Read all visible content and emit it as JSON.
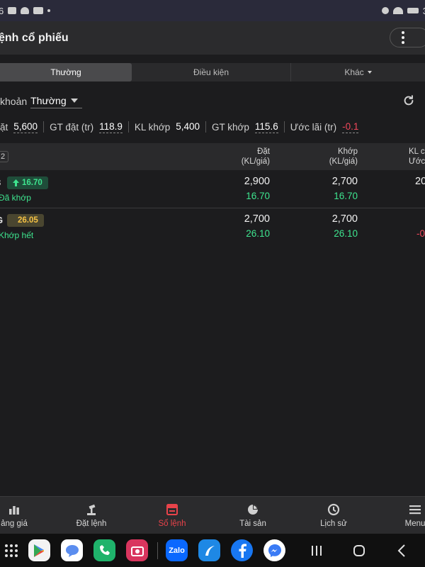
{
  "status_bar": {
    "time_fragment": "6",
    "right_fragment": "3"
  },
  "header": {
    "title": "ệnh cổ phiếu"
  },
  "tabs": [
    {
      "label": "Thường",
      "active": true
    },
    {
      "label": "Điều kiện",
      "active": false
    },
    {
      "label": "Khác",
      "active": false
    }
  ],
  "account": {
    "label": "khoản",
    "value": "Thường"
  },
  "summary": {
    "items": [
      {
        "key": "ặt",
        "value": "5,600"
      },
      {
        "key": "GT đặt (tr)",
        "value": "118.9"
      },
      {
        "key": "KL khớp",
        "value": "5,400"
      },
      {
        "key": "GT khớp",
        "value": "115.6"
      },
      {
        "key": "Ước lãi (tr)",
        "value": "-0.1"
      }
    ]
  },
  "table": {
    "count": "2",
    "headers": {
      "placed_line1": "Đặt",
      "placed_line2": "(KL/giá)",
      "matched_line1": "Khớp",
      "matched_line2": "(KL/giá)",
      "extra_line1": "KL c",
      "extra_line2": "Ước"
    },
    "rows": [
      {
        "edge": "3",
        "tag_price": "16.70",
        "tag_kind": "up",
        "status": "Đã khớp",
        "placed_qty": "2,900",
        "placed_price": "16.70",
        "matched_qty": "2,700",
        "matched_price": "16.70",
        "extra_top": "20",
        "extra_bottom": ""
      },
      {
        "edge": "G",
        "tag_price": "26.05",
        "tag_kind": "ref",
        "status": "Khớp hết",
        "placed_qty": "2,700",
        "placed_price": "26.10",
        "matched_qty": "2,700",
        "matched_price": "26.10",
        "extra_top": "",
        "extra_bottom": "-0"
      }
    ]
  },
  "bottom_nav": [
    {
      "label": "ảng giá",
      "icon": "chart-bars-icon",
      "active": false
    },
    {
      "label": "Đặt lệnh",
      "icon": "gavel-icon",
      "active": false
    },
    {
      "label": "Sổ lệnh",
      "icon": "order-book-icon",
      "active": true
    },
    {
      "label": "Tài sản",
      "icon": "pie-chart-icon",
      "active": false
    },
    {
      "label": "Lịch sử",
      "icon": "clock-icon",
      "active": false
    },
    {
      "label": "Menu",
      "icon": "hamburger-icon",
      "active": false
    }
  ],
  "dock": {
    "apps": [
      {
        "name": "play-store-icon",
        "color": "#ffffff"
      },
      {
        "name": "messages-icon",
        "color": "#5b8def"
      },
      {
        "name": "phone-icon",
        "color": "#1fb36b"
      },
      {
        "name": "camera-icon",
        "color": "#d9355e"
      },
      {
        "name": "zalo-icon",
        "color": "#0a68ff",
        "text": "Zalo"
      },
      {
        "name": "fireant-icon",
        "color": "#1e88e5"
      },
      {
        "name": "facebook-icon",
        "color": "#1877f2"
      },
      {
        "name": "messenger-icon",
        "color": "#3a7bf5"
      }
    ]
  },
  "colors": {
    "accent_red": "#e8434a",
    "up_green": "#3ee58f",
    "ref_yellow": "#f6c244",
    "loss_red": "#f2475b"
  }
}
